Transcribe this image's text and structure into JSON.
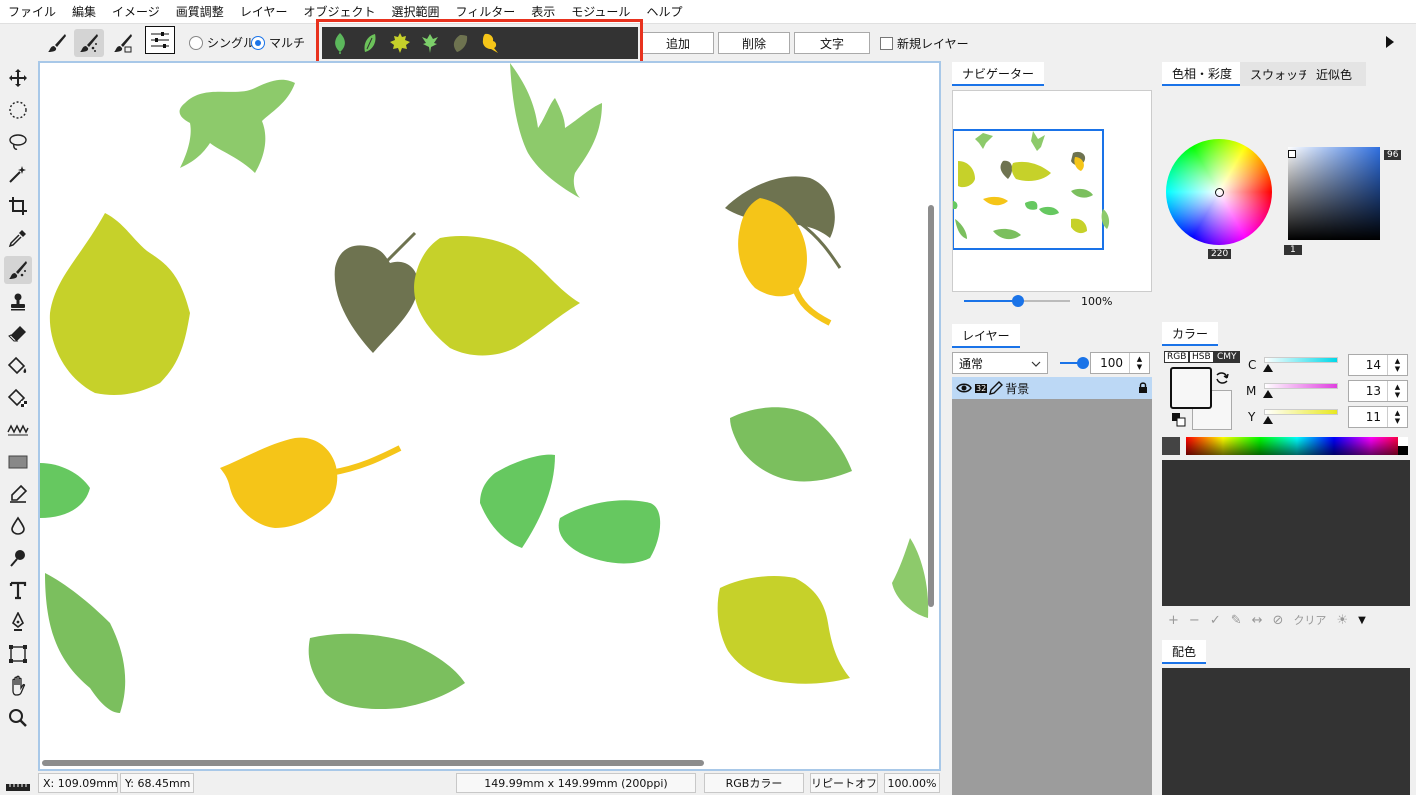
{
  "menu": [
    "ファイル",
    "編集",
    "イメージ",
    "画質調整",
    "レイヤー",
    "オブジェクト",
    "選択範囲",
    "フィルター",
    "表示",
    "モジュール",
    "ヘルプ"
  ],
  "options": {
    "single_label": "シングル",
    "multi_label": "マルチ",
    "add_label": "追加",
    "delete_label": "削除",
    "text_label": "文字",
    "new_layer_label": "新規レイヤー",
    "mode": "multi"
  },
  "shape_strip": {
    "shapes": [
      "leaf-green-icon",
      "leaf-light-green-icon",
      "maple-leaf-yellow-icon",
      "fern-leaf-green-icon",
      "leaf-olive-icon",
      "leaf-yellow-icon"
    ],
    "colors": [
      "#5cb85c",
      "#6cc25a",
      "#c6d12a",
      "#7ccf6a",
      "#6e7350",
      "#f5c518"
    ]
  },
  "tools": [
    "move-icon",
    "ellipse-select-icon",
    "lasso-icon",
    "magic-wand-icon",
    "crop-icon",
    "eyedropper-icon",
    "shape-brush-icon",
    "stamp-icon",
    "eraser-icon",
    "bucket-icon",
    "gradient-bucket-icon",
    "wave-icon",
    "rectangle-icon",
    "pen-icon",
    "drop-icon",
    "smudge-icon",
    "text-icon",
    "vector-pen-icon",
    "transform-icon",
    "hand-icon",
    "zoom-icon"
  ],
  "status": {
    "x_label": "X:",
    "x_value": "109.09mm",
    "y_label": "Y:",
    "y_value": "68.45mm",
    "size": "149.99mm x 149.99mm (200ppi)",
    "color_mode": "RGBカラー",
    "repeat": "リピートオフ",
    "zoom": "100.00%"
  },
  "navigator": {
    "tab": "ナビゲーター",
    "zoom": "100%",
    "zoom_fraction": 0.5
  },
  "layers": {
    "tab": "レイヤー",
    "blend_mode": "通常",
    "opacity": "100",
    "opacity_fraction": 1.0,
    "items": [
      {
        "bit": "32",
        "name": "背景",
        "locked": true
      }
    ]
  },
  "color_panel": {
    "tabs": [
      "色相・彩度",
      "スウォッチ",
      "近似色"
    ],
    "hue_value": "220",
    "saturation_value": "96",
    "brightness_value": "1"
  },
  "kara": {
    "tab": "カラー",
    "modes": [
      "RGB",
      "HSB",
      "CMY"
    ],
    "active_mode": "CMY",
    "channels": [
      {
        "label": "C",
        "value": "14",
        "color": "#00d8e8"
      },
      {
        "label": "M",
        "value": "13",
        "color": "#e040e0"
      },
      {
        "label": "Y",
        "value": "11",
        "color": "#e8e820"
      }
    ],
    "clear_label": "クリア"
  },
  "haishoku": {
    "tab": "配色"
  }
}
